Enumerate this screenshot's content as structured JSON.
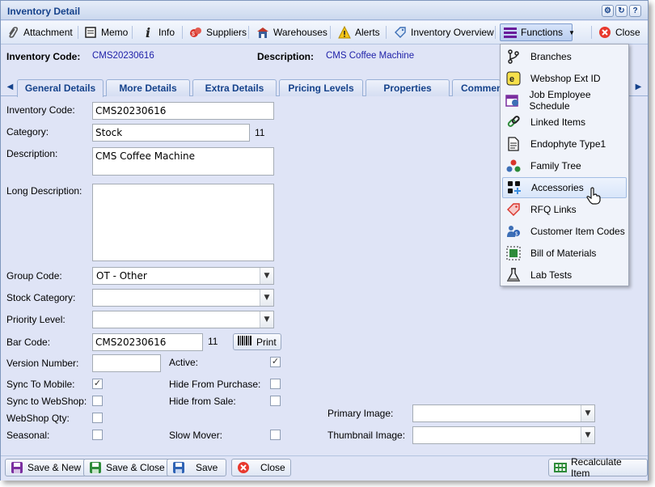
{
  "window": {
    "title": "Inventory Detail"
  },
  "toolbar": {
    "attachment": "Attachment",
    "memo": "Memo",
    "info": "Info",
    "suppliers": "Suppliers",
    "warehouses": "Warehouses",
    "alerts": "Alerts",
    "inventory_overview": "Inventory Overview",
    "functions": "Functions",
    "close": "Close"
  },
  "header": {
    "code_label": "Inventory Code:",
    "code_value": "CMS20230616",
    "desc_label": "Description:",
    "desc_value": "CMS Coffee Machine"
  },
  "tabs": [
    "General Details",
    "More Details",
    "Extra Details",
    "Pricing Levels",
    "Properties",
    "Commen"
  ],
  "form": {
    "inventory_code_label": "Inventory Code:",
    "inventory_code": "CMS20230616",
    "category_label": "Category:",
    "category": "Stock",
    "category_count": "11",
    "description_label": "Description:",
    "description": "CMS Coffee Machine",
    "long_description_label": "Long Description:",
    "long_description": "",
    "group_code_label": "Group Code:",
    "group_code": "OT - Other",
    "stock_category_label": "Stock Category:",
    "stock_category": "",
    "priority_level_label": "Priority Level:",
    "priority_level": "",
    "bar_code_label": "Bar Code:",
    "bar_code": "CMS20230616",
    "bar_code_count": "11",
    "print_label": "Print",
    "version_number_label": "Version Number:",
    "version_number": "",
    "active_label": "Active:",
    "sync_mobile_label": "Sync To Mobile:",
    "hide_purchase_label": "Hide From Purchase:",
    "sync_webshop_label": "Sync to WebShop:",
    "hide_sale_label": "Hide from Sale:",
    "webshop_qty_label": "WebShop Qty:",
    "seasonal_label": "Seasonal:",
    "slow_mover_label": "Slow Mover:",
    "primary_image_label": "Primary Image:",
    "thumbnail_image_label": "Thumbnail Image:"
  },
  "menu": {
    "items": [
      "Branches",
      "Webshop Ext ID",
      "Job Employee Schedule",
      "Linked Items",
      "Endophyte Type1",
      "Family Tree",
      "Accessories",
      "RFQ Links",
      "Customer Item Codes",
      "Bill of Materials",
      "Lab Tests"
    ]
  },
  "buttons": {
    "save_new": "Save & New",
    "save_close": "Save & Close",
    "save": "Save",
    "close": "Close",
    "recalculate": "Recalculate Item"
  }
}
